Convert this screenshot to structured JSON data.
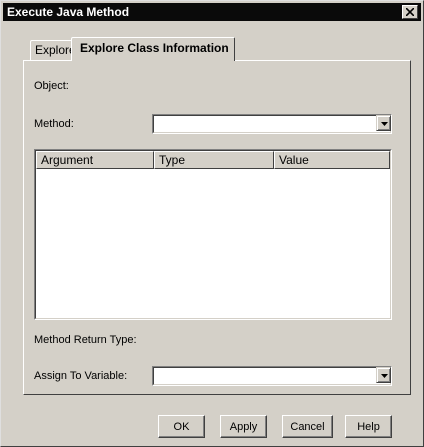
{
  "window": {
    "title": "Execute Java Method"
  },
  "tabs": [
    {
      "label": "Explore",
      "active": false
    },
    {
      "label": "Explore Class Information",
      "active": true
    }
  ],
  "form": {
    "object_label": "Object:",
    "method_label": "Method:",
    "method_value": "",
    "return_type_label": "Method Return Type:",
    "assign_label": "Assign To Variable:",
    "assign_value": ""
  },
  "table": {
    "columns": [
      "Argument",
      "Type",
      "Value"
    ],
    "rows": []
  },
  "buttons": {
    "ok": "OK",
    "apply": "Apply",
    "cancel": "Cancel",
    "help": "Help"
  },
  "icons": {
    "close": "close-icon",
    "dropdown": "chevron-down-icon"
  }
}
